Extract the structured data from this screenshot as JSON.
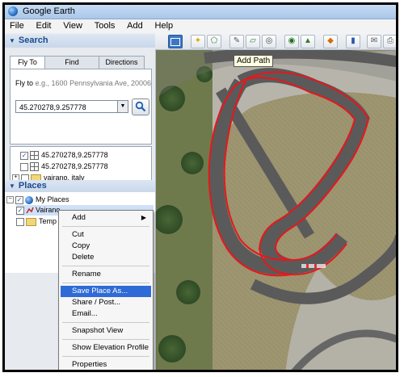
{
  "window": {
    "title": "Google Earth"
  },
  "menubar": [
    "File",
    "Edit",
    "View",
    "Tools",
    "Add",
    "Help"
  ],
  "search": {
    "header": "Search",
    "tabs": [
      "Fly To",
      "Find Businesses",
      "Directions"
    ],
    "hint_prefix": "Fly to",
    "hint_example": "e.g., 1600 Pennsylvania Ave, 20006",
    "input_value": "45.270278,9.257778",
    "results": [
      "45.270278,9.257778",
      "45.270278,9.257778",
      "vairano, italy"
    ],
    "close_label": "x"
  },
  "places": {
    "header": "Places",
    "my_places": "My Places",
    "selected_item": "Vairano",
    "temp_item": "Temp"
  },
  "toolbar": {
    "tooltip": "Add Path"
  },
  "context_menu": {
    "items": [
      "Add",
      "Cut",
      "Copy",
      "Delete",
      "Rename",
      "Save Place As...",
      "Share / Post...",
      "Email...",
      "Snapshot View",
      "Show Elevation Profile",
      "Properties"
    ],
    "highlighted": "Save Place As..."
  },
  "colors": {
    "path": "#e8161b",
    "highlight": "#2e6bd6"
  }
}
